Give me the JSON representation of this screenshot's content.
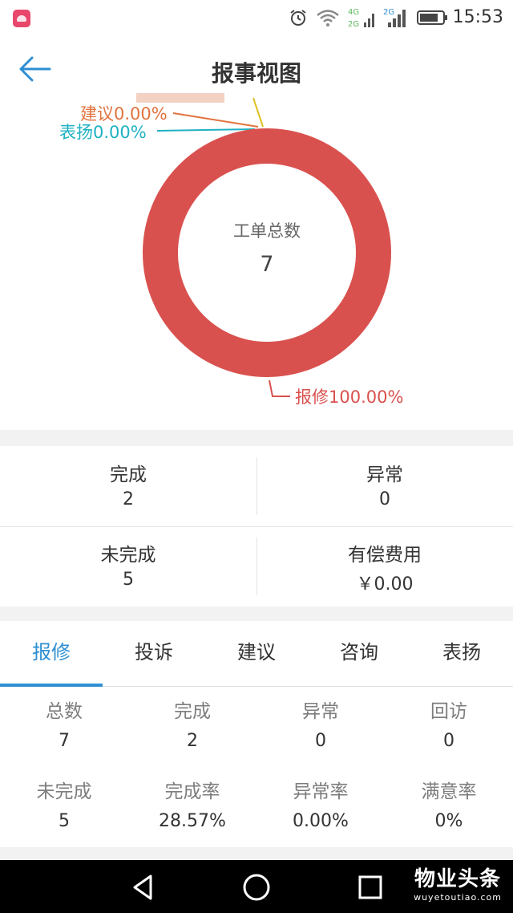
{
  "status_bar": {
    "time": "15:53",
    "net_4g": "4G",
    "net_2g_a": "2G",
    "net_2g_b": "2G"
  },
  "header": {
    "title": "报事视图"
  },
  "chart_data": {
    "type": "pie",
    "center_label": "工单总数",
    "center_value": "7",
    "slices": [
      {
        "name": "报修",
        "value": 100.0,
        "label": "报修100.00%",
        "color": "#d9514e"
      },
      {
        "name": "表扬",
        "value": 0.0,
        "label": "表扬0.00%",
        "color": "#1fb1c2"
      },
      {
        "name": "建议",
        "value": 0.0,
        "label": "建议0.00%",
        "color": "#e0733e"
      }
    ]
  },
  "summary": {
    "completed_label": "完成",
    "completed_value": "2",
    "abnormal_label": "异常",
    "abnormal_value": "0",
    "incomplete_label": "未完成",
    "incomplete_value": "5",
    "fee_label": "有偿费用",
    "fee_value": "￥0.00"
  },
  "tabs": [
    {
      "label": "报修",
      "active": true
    },
    {
      "label": "投诉",
      "active": false
    },
    {
      "label": "建议",
      "active": false
    },
    {
      "label": "咨询",
      "active": false
    },
    {
      "label": "表扬",
      "active": false
    }
  ],
  "stats": [
    {
      "label": "总数",
      "value": "7"
    },
    {
      "label": "完成",
      "value": "2"
    },
    {
      "label": "异常",
      "value": "0"
    },
    {
      "label": "回访",
      "value": "0"
    },
    {
      "label": "未完成",
      "value": "5"
    },
    {
      "label": "完成率",
      "value": "28.57%"
    },
    {
      "label": "异常率",
      "value": "0.00%"
    },
    {
      "label": "满意率",
      "value": "0%"
    }
  ],
  "nav": {
    "icons": [
      "back-triangle-icon",
      "home-circle-icon",
      "recents-square-icon"
    ]
  },
  "watermark": {
    "main": "物业头条",
    "sub": "wuyetoutiao.com"
  },
  "colors": {
    "accent": "#2e8fd3",
    "donut": "#d9514e"
  }
}
